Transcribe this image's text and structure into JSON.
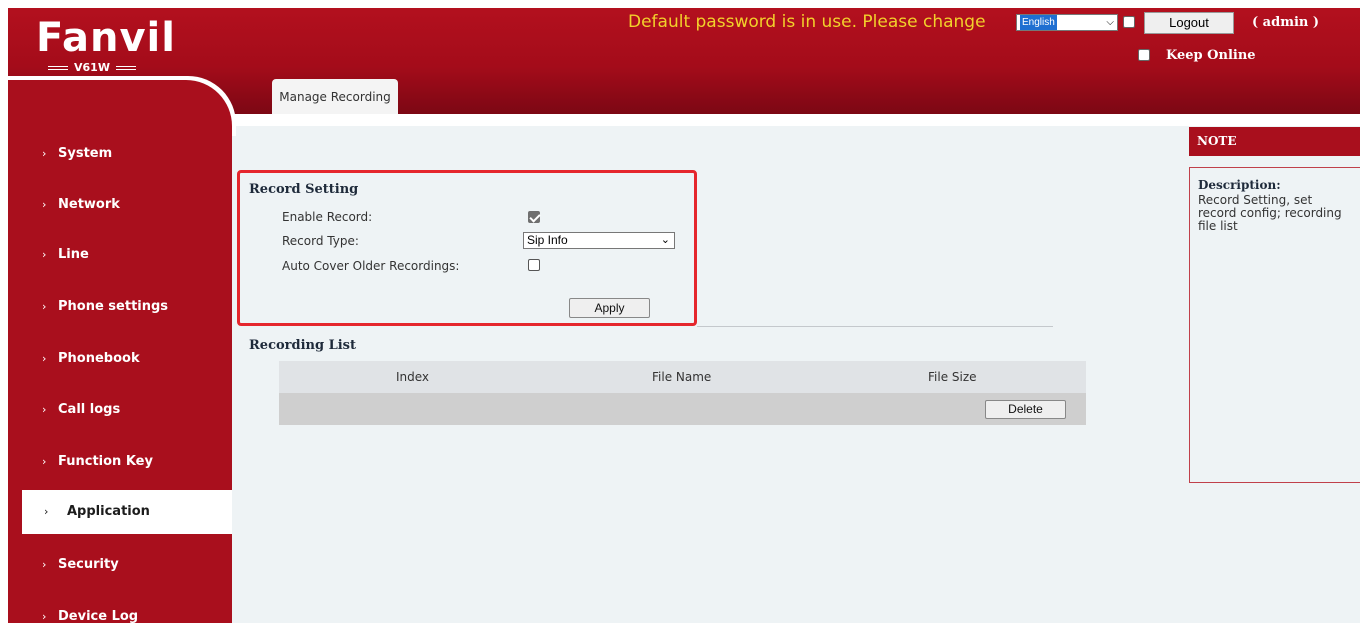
{
  "header": {
    "logo_word": "Fanvil",
    "model": "V61W",
    "warning": "Default password is in use. Please change",
    "language": "English",
    "logout_label": "Logout",
    "user_label": "( admin )",
    "keep_online_label": "Keep Online"
  },
  "tabs": [
    {
      "label": "Manage Recording"
    }
  ],
  "sidebar": {
    "items": [
      {
        "label": "System"
      },
      {
        "label": "Network"
      },
      {
        "label": "Line"
      },
      {
        "label": "Phone settings"
      },
      {
        "label": "Phonebook"
      },
      {
        "label": "Call logs"
      },
      {
        "label": "Function Key"
      },
      {
        "label": "Application",
        "active": true
      },
      {
        "label": "Security"
      },
      {
        "label": "Device Log"
      }
    ]
  },
  "record_setting": {
    "title": "Record Setting",
    "enable_label": "Enable Record:",
    "enable_checked": true,
    "type_label": "Record Type:",
    "type_value": "Sip Info",
    "auto_cover_label": "Auto Cover Older Recordings:",
    "auto_cover_checked": false,
    "apply_label": "Apply"
  },
  "recording_list": {
    "title": "Recording List",
    "columns": [
      "Index",
      "File Name",
      "File Size"
    ],
    "delete_label": "Delete"
  },
  "note": {
    "header": "NOTE",
    "title": "Description:",
    "text": "Record Setting, set record config; recording file list"
  },
  "colors": {
    "brand_red": "#a90f1d",
    "warning_yellow": "#f2d12b",
    "highlight": "#e5262d",
    "content_bg": "#eef3f5"
  }
}
